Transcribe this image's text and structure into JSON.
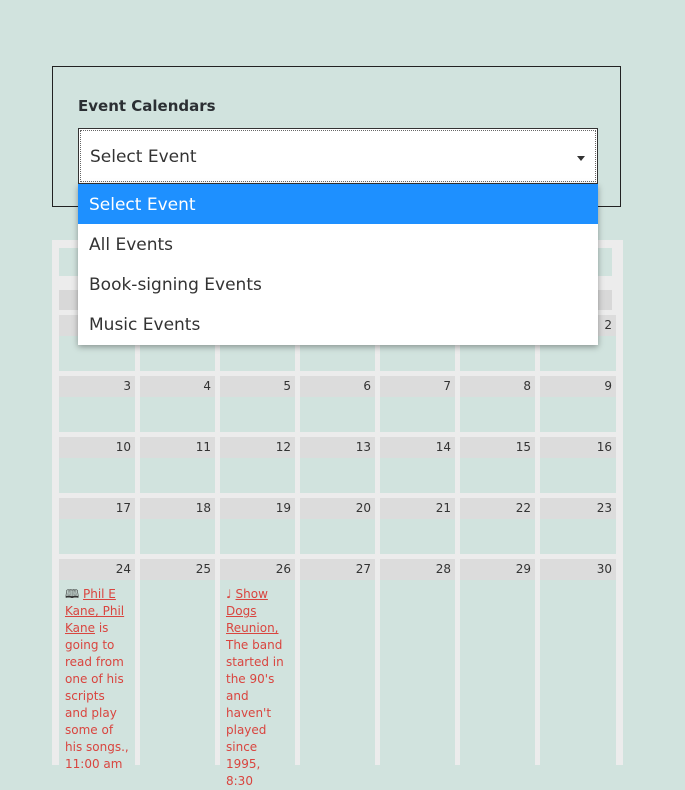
{
  "widget": {
    "title": "Event Calendars",
    "select_value": "Select Event",
    "options": [
      "Select Event",
      "All Events",
      "Book-signing Events",
      "Music Events"
    ]
  },
  "calendar": {
    "rows": [
      [
        "",
        "",
        "",
        "",
        "",
        "",
        "2"
      ],
      [
        "3",
        "4",
        "5",
        "6",
        "7",
        "8",
        "9"
      ],
      [
        "10",
        "11",
        "12",
        "13",
        "14",
        "15",
        "16"
      ],
      [
        "17",
        "18",
        "19",
        "20",
        "21",
        "22",
        "23"
      ],
      [
        "24",
        "25",
        "26",
        "27",
        "28",
        "29",
        "30"
      ]
    ],
    "events": {
      "day24": {
        "icon": "book-icon",
        "link": "Phil E Kane, Phil Kane",
        "text": "is going to read from one of his scripts and play some of his songs., 11:00 am"
      },
      "day26": {
        "icon": "music-note-icon",
        "link": "Show Dogs Reunion,",
        "text": "The band started in the 90's and haven't played since 1995, 8:30"
      }
    }
  }
}
